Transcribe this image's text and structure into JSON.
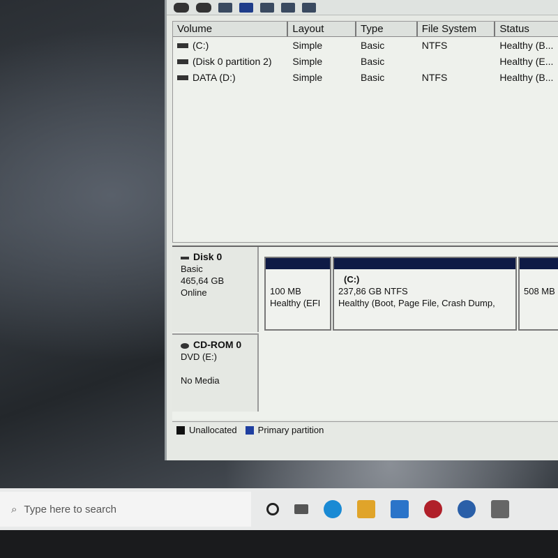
{
  "volume_list": {
    "columns": [
      "Volume",
      "Layout",
      "Type",
      "File System",
      "Status"
    ],
    "rows": [
      [
        "(C:)",
        "Simple",
        "Basic",
        "NTFS",
        "Healthy (B..."
      ],
      [
        "(Disk 0 partition 2)",
        "Simple",
        "Basic",
        "",
        "Healthy (E..."
      ],
      [
        "DATA (D:)",
        "Simple",
        "Basic",
        "NTFS",
        "Healthy (B..."
      ]
    ]
  },
  "disks": [
    {
      "name": "Disk 0",
      "type": "Basic",
      "size": "465,64 GB",
      "state": "Online",
      "partitions": [
        {
          "label": "",
          "size": "100 MB",
          "status": "Healthy (EFI"
        },
        {
          "label": "(C:)",
          "size": "237,86 GB NTFS",
          "status": "Healthy (Boot, Page File, Crash Dump,"
        },
        {
          "label": "",
          "size": "508 MB",
          "status": ""
        }
      ]
    },
    {
      "name": "CD-ROM 0",
      "type": "DVD (E:)",
      "size": "",
      "state": "No Media"
    }
  ],
  "legend": [
    {
      "label": "Unallocated",
      "color": "#111111"
    },
    {
      "label": "Primary partition",
      "color": "#1f3fa0"
    }
  ],
  "taskbar": {
    "search_placeholder": "Type here to search"
  }
}
